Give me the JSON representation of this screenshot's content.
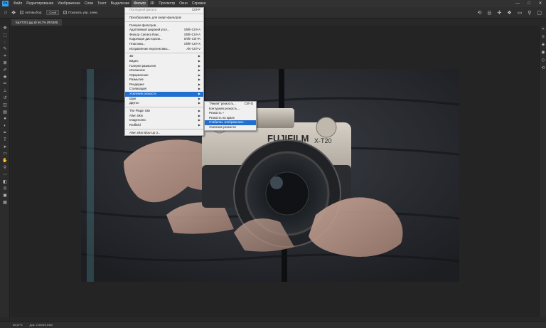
{
  "menubar": {
    "logo": "Ps",
    "items": [
      "Файл",
      "Редактирование",
      "Изображение",
      "Слои",
      "Текст",
      "Выделение",
      "Фильтр",
      "3D",
      "Просмотр",
      "Окно",
      "Справка"
    ],
    "active_index": 6
  },
  "window_controls": [
    "—",
    "□",
    "✕"
  ],
  "options": {
    "autoselect_label": "Автовыбор:",
    "autoselect_value": "Слой",
    "show_controls_label": "Показать упр. элем."
  },
  "tab": {
    "title": "fujiXT201.jpg @ 66,7% (RGB/8)"
  },
  "filter_menu": {
    "items": [
      {
        "label": "Последний фильтр",
        "shortcut": "Ctrl+F",
        "disabled": true
      },
      {
        "sep": true
      },
      {
        "label": "Преобразовать для смарт-фильтров"
      },
      {
        "sep": true
      },
      {
        "label": "Галерея фильтров..."
      },
      {
        "label": "Адаптивный широкий угол...",
        "shortcut": "Shift+Ctrl+A"
      },
      {
        "label": "Фильтр Camera Raw...",
        "shortcut": "Shift+Ctrl+A"
      },
      {
        "label": "Коррекция дисторсии...",
        "shortcut": "Shift+Ctrl+R"
      },
      {
        "label": "Пластика...",
        "shortcut": "Shift+Ctrl+X"
      },
      {
        "label": "Исправление перспективы...",
        "shortcut": "Alt+Ctrl+V"
      },
      {
        "sep": true
      },
      {
        "label": "3D",
        "sub": true
      },
      {
        "label": "Видео",
        "sub": true
      },
      {
        "label": "Галерея размытия",
        "sub": true
      },
      {
        "label": "Искажение",
        "sub": true
      },
      {
        "label": "Оформление",
        "sub": true
      },
      {
        "label": "Размытие",
        "sub": true
      },
      {
        "label": "Рендеринг",
        "sub": true
      },
      {
        "label": "Стилизация",
        "sub": true
      },
      {
        "label": "Усиление резкости",
        "sub": true,
        "highlight": true
      },
      {
        "label": "Шум",
        "sub": true
      },
      {
        "label": "Другое",
        "sub": true
      },
      {
        "sep": true
      },
      {
        "label": "The Plugin Site",
        "sub": true
      },
      {
        "label": "Alien Skin",
        "sub": true
      },
      {
        "label": "Imagenomic",
        "sub": true
      },
      {
        "label": "Redfield",
        "sub": true
      },
      {
        "sep": true
      },
      {
        "label": "Alien Skin Blow Up 3..."
      }
    ]
  },
  "sharpen_submenu": {
    "items": [
      {
        "label": "\"Умная\" резкость...",
        "shortcut": "Ctrl+D"
      },
      {
        "label": "Контурная резкость..."
      },
      {
        "label": "Резкость +"
      },
      {
        "label": "Резкость на краях"
      },
      {
        "label": "Стабилиз. изображения...",
        "highlight": true
      },
      {
        "label": "Усиление резкости"
      }
    ]
  },
  "photo": {
    "brand": "FUJIFILM",
    "model": "X-T20"
  },
  "status": {
    "zoom": "66,67%",
    "doc": "Док: 2,64M/2,64M"
  },
  "colors": {
    "accent": "#1f6fd1",
    "menu_bg": "#f0f0f0",
    "app_bg": "#282828"
  }
}
